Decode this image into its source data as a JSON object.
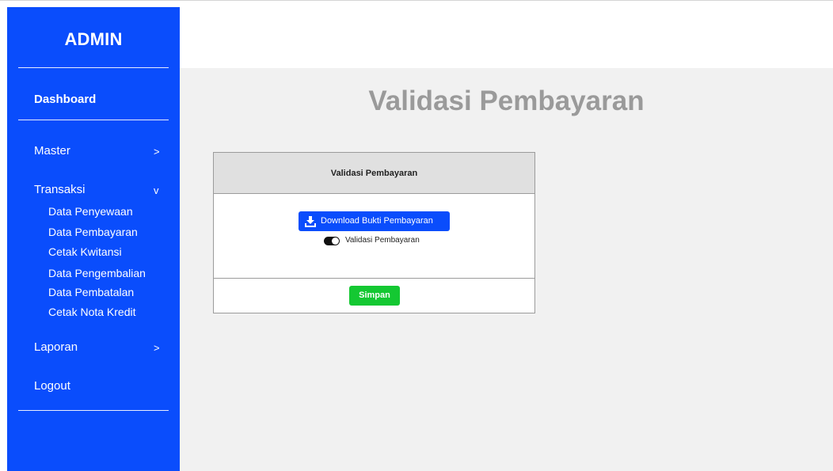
{
  "sidebar": {
    "brand": "ADMIN",
    "dashboard": "Dashboard",
    "menu": {
      "master": {
        "label": "Master",
        "chevron": ">"
      },
      "transaksi": {
        "label": "Transaksi",
        "chevron": "v",
        "items": [
          "Data Penyewaan",
          "Data Pembayaran",
          "Cetak Kwitansi",
          "Data Pengembalian",
          "Data Pembatalan",
          "Cetak Nota Kredit"
        ]
      },
      "laporan": {
        "label": "Laporan",
        "chevron": ">"
      },
      "logout": {
        "label": "Logout"
      }
    }
  },
  "main": {
    "title": "Validasi Pembayaran",
    "card": {
      "header": "Validasi Pembayaran",
      "download_button": "Download Bukti Pembayaran",
      "download_icon": "download-icon",
      "toggle_label": "Validasi Pembayaran",
      "toggle_on": true,
      "save_button": "Simpan"
    }
  },
  "colors": {
    "sidebar": "#0a4dfc",
    "main_bg": "#f1f1f1",
    "title": "#9a9a9a",
    "save": "#14c832"
  }
}
